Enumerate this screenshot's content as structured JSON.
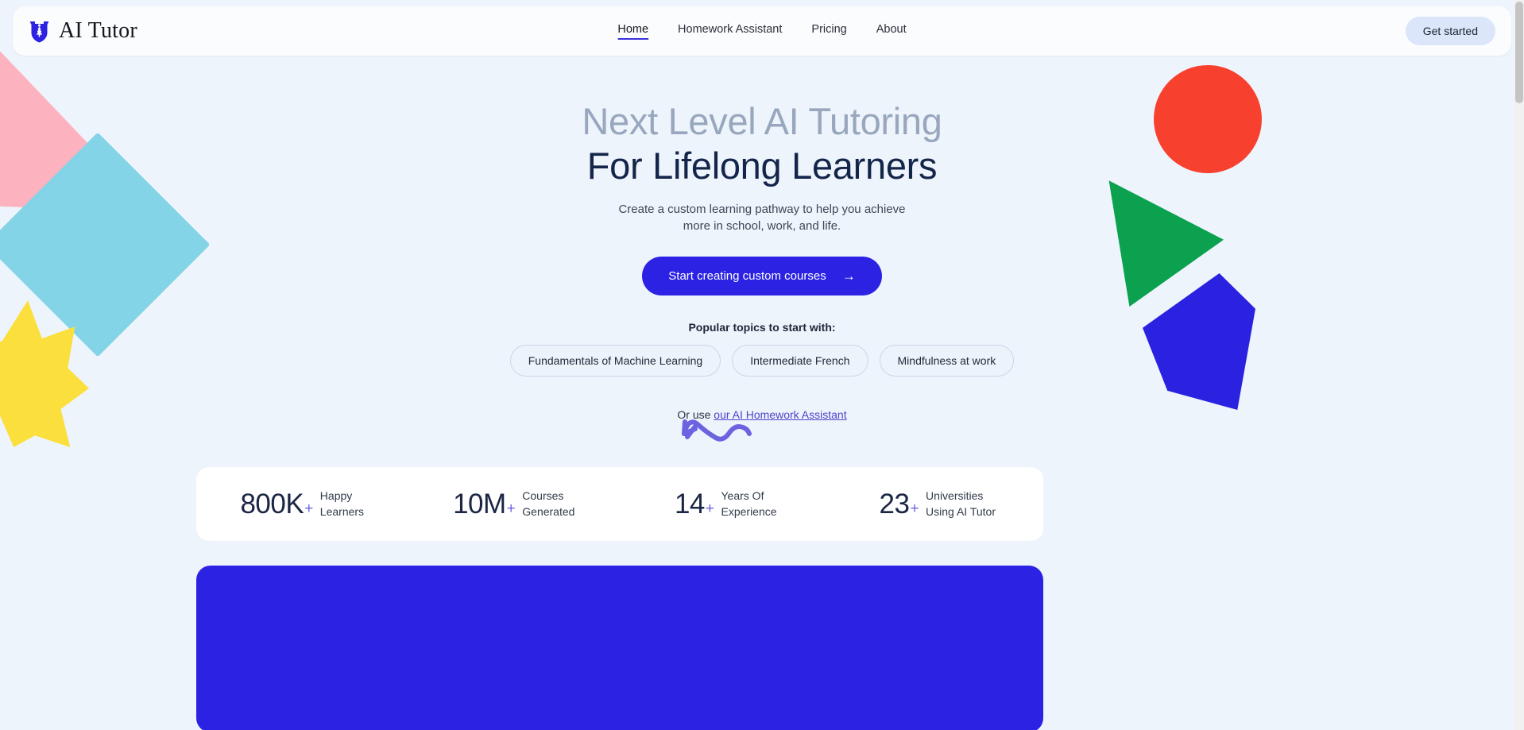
{
  "brand": {
    "name": "AI Tutor",
    "logo_icon": "shield-tree-icon",
    "logo_color": "#2b22e4"
  },
  "nav": {
    "items": [
      {
        "label": "Home",
        "active": true
      },
      {
        "label": "Homework Assistant",
        "active": false
      },
      {
        "label": "Pricing",
        "active": false
      },
      {
        "label": "About",
        "active": false
      }
    ],
    "cta_label": "Get started"
  },
  "hero": {
    "headline_line1": "Next Level AI Tutoring",
    "headline_line2": "For Lifelong Learners",
    "subhead_line1": "Create a custom learning pathway to help you achieve",
    "subhead_line2": "more in school, work, and life.",
    "cta_label": "Start creating custom courses",
    "cta_arrow": "→",
    "topics_label": "Popular topics to start with:",
    "topics": [
      "Fundamentals of Machine Learning",
      "Intermediate French",
      "Mindfulness at work"
    ],
    "or_use_prefix": "Or use ",
    "or_use_link": "our AI Homework Assistant",
    "squiggle_icon": "curved-arrow-icon"
  },
  "stats": [
    {
      "value": "800K",
      "plus": "+",
      "label_line1": "Happy",
      "label_line2": "Learners"
    },
    {
      "value": "10M",
      "plus": "+",
      "label_line1": "Courses",
      "label_line2": "Generated"
    },
    {
      "value": "14",
      "plus": "+",
      "label_line1": "Years Of",
      "label_line2": "Experience"
    },
    {
      "value": "23",
      "plus": "+",
      "label_line1": "Universities",
      "label_line2": "Using AI Tutor"
    }
  ],
  "bottom_banner": {
    "title": ""
  },
  "decorations": [
    {
      "name": "pink-quadrilateral",
      "color": "#fdb2bf"
    },
    {
      "name": "cyan-diamond",
      "color": "#84d4e8"
    },
    {
      "name": "yellow-star",
      "color": "#fbdf3c"
    },
    {
      "name": "red-circle",
      "color": "#f8402e"
    },
    {
      "name": "green-triangle",
      "color": "#0ba14e"
    },
    {
      "name": "blue-pentagon",
      "color": "#2a22e0"
    }
  ],
  "theme": {
    "page_background": "#eef4fc",
    "accent_blue": "#2b22e4",
    "link_purple": "#4a44c9",
    "header_background": "#fbfcfe"
  }
}
